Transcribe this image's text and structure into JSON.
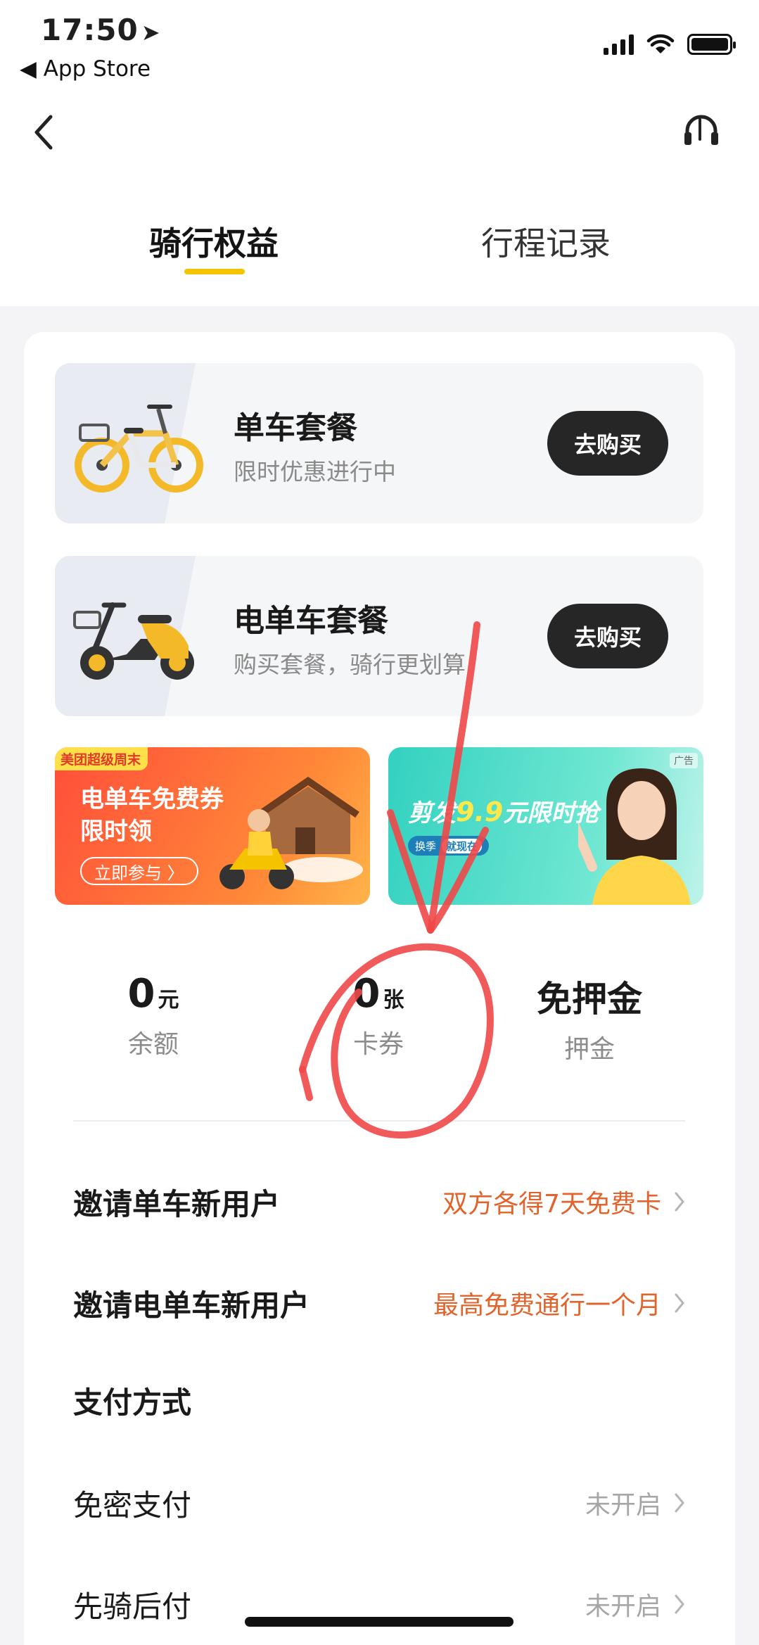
{
  "status_bar": {
    "time": "17:50",
    "location_arrow": "➤",
    "back_app": "◀ App Store"
  },
  "header": {
    "back_icon": "chevron-left-icon",
    "support_icon": "headset-icon"
  },
  "tabs": [
    {
      "label": "骑行权益",
      "active": true
    },
    {
      "label": "行程记录",
      "active": false
    }
  ],
  "packages": [
    {
      "title": "单车套餐",
      "subtitle": "限时优惠进行中",
      "button": "去购买",
      "image": "bike-icon"
    },
    {
      "title": "电单车套餐",
      "subtitle": "购买套餐，骑行更划算",
      "button": "去购买",
      "image": "ebike-icon"
    }
  ],
  "banners": {
    "left": {
      "tag": "美团超级周末",
      "line1": "电单车免费券",
      "line2": "限时领",
      "cta": "立即参与 〉",
      "colors": [
        "#ff4d3a",
        "#ffb54a"
      ]
    },
    "right": {
      "ad_label": "广告",
      "headline_pre": "剪发",
      "headline_price": "9.9",
      "headline_post": "元限时抢",
      "pill_left": "换季",
      "pill_right": "就现在",
      "colors": [
        "#33d1c0",
        "#bff3ea"
      ]
    }
  },
  "stats": [
    {
      "value": "0",
      "unit": "元",
      "label": "余额"
    },
    {
      "value": "0",
      "unit": "张",
      "label": "卡券"
    },
    {
      "value": "免押金",
      "unit": "",
      "label": "押金"
    }
  ],
  "rows": [
    {
      "name": "邀请单车新用户",
      "value": "双方各得7天免费卡",
      "type": "promo"
    },
    {
      "name": "邀请电单车新用户",
      "value": "最高免费通行一个月",
      "type": "promo"
    }
  ],
  "payment": {
    "title": "支付方式",
    "items": [
      {
        "name": "免密支付",
        "value": "未开启"
      },
      {
        "name": "先骑后付",
        "value": "未开启"
      }
    ]
  },
  "colors": {
    "accent": "#f5c400",
    "promo": "#e0642b",
    "button": "#262626",
    "annotation": "#f04848"
  }
}
